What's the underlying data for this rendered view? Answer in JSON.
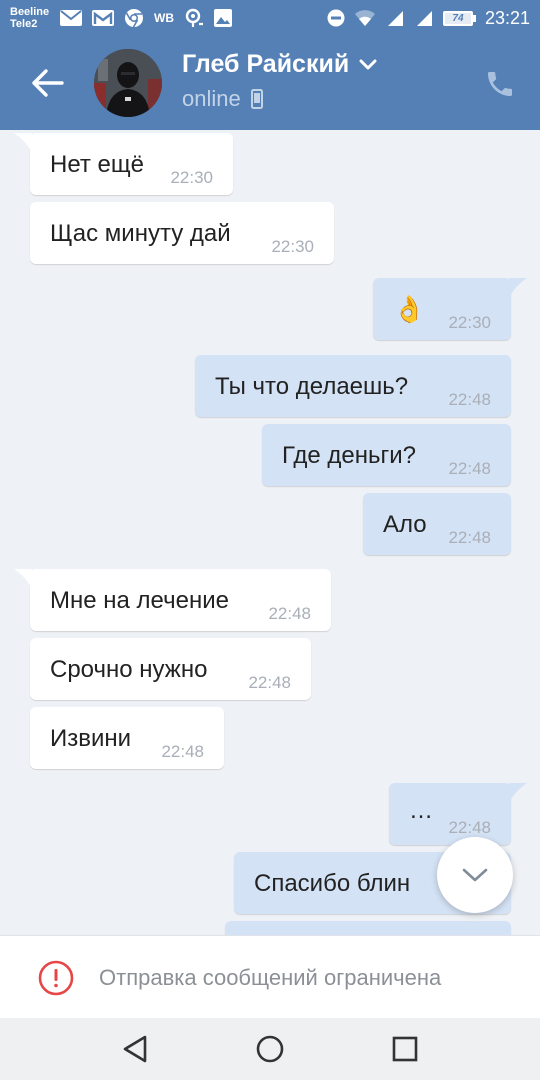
{
  "status_bar": {
    "carrier_1": "Beeline",
    "carrier_2": "Tele2",
    "time": "23:21",
    "battery_percent": "74",
    "notification_icons": [
      "mail-icon",
      "gmail-icon",
      "chrome-icon",
      "wb-icon",
      "location-icon",
      "image-icon"
    ],
    "wb_label": "WB"
  },
  "header": {
    "contact_name": "Глеб Райский",
    "status": "online",
    "accent_color": "#5580b5"
  },
  "messages": [
    {
      "direction": "in",
      "text": "Нет ещё",
      "time": "22:30"
    },
    {
      "direction": "in",
      "text": "Щас минуту дай",
      "time": "22:30"
    },
    {
      "direction": "out",
      "text": "👌",
      "time": "22:30"
    },
    {
      "direction": "out",
      "text": "Ты что делаешь?",
      "time": "22:48"
    },
    {
      "direction": "out",
      "text": "Где деньги?",
      "time": "22:48"
    },
    {
      "direction": "out",
      "text": "Ало",
      "time": "22:48"
    },
    {
      "direction": "in",
      "text": "Мне на лечение",
      "time": "22:48"
    },
    {
      "direction": "in",
      "text": "Срочно нужно",
      "time": "22:48"
    },
    {
      "direction": "in",
      "text": "Извини",
      "time": "22:48"
    },
    {
      "direction": "out",
      "text": "…",
      "time": "22:48"
    },
    {
      "direction": "out",
      "text": "Спасибо блин",
      "time": ""
    },
    {
      "direction": "out",
      "text": "",
      "time": ""
    }
  ],
  "footer": {
    "restricted_text": "Отправка сообщений ограничена"
  },
  "colors": {
    "incoming_bubble": "#ffffff",
    "outgoing_bubble": "#d4e2f5",
    "chat_background": "#eef1f5",
    "alert_red": "#e64646"
  }
}
